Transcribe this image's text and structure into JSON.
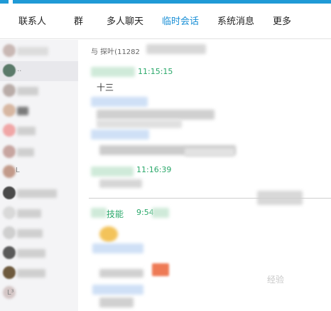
{
  "tabs": [
    {
      "label": "联系人",
      "active": false
    },
    {
      "label": "群",
      "active": false
    },
    {
      "label": "多人聊天",
      "active": false
    },
    {
      "label": "临时会话",
      "active": true
    },
    {
      "label": "系统消息",
      "active": false
    },
    {
      "label": "更多",
      "active": false
    }
  ],
  "colors": {
    "accent": "#1a8fd6",
    "header_bar": "#1f9ad6",
    "sidebar_bg": "#f4f4f6",
    "time_green": "#2aa86a"
  },
  "sidebar": {
    "partial_label_1": "..",
    "partial_label_2": "L",
    "partial_label_3": "L³"
  },
  "chat": {
    "header_prefix": "与 探叶(11282",
    "msg1_time": "11:15:15",
    "msg1_text": "十三",
    "msg3_time": "11:16:39",
    "msg4_name_part": "技能",
    "msg4_time": "9:54"
  },
  "watermark": {
    "text": "经验"
  }
}
